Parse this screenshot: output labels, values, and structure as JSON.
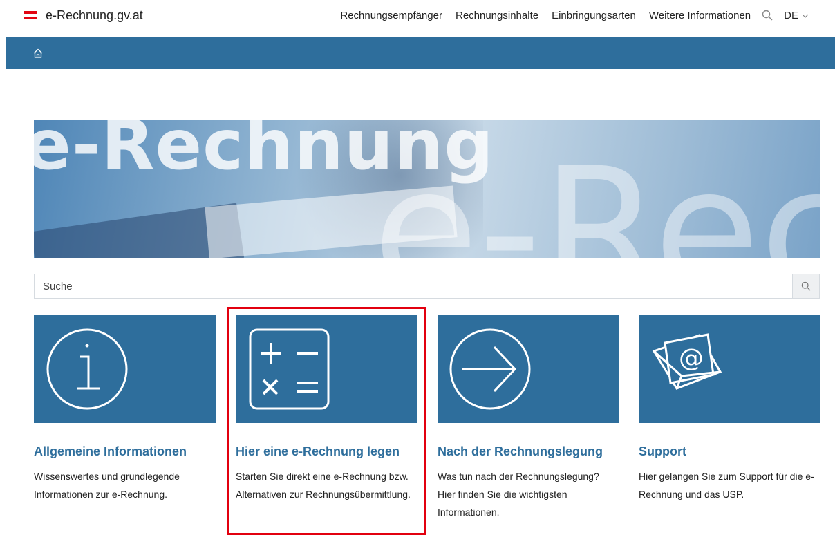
{
  "header": {
    "logo_text": "e-Rechnung.gv.at",
    "nav": [
      "Rechnungsempfänger",
      "Rechnungsinhalte",
      "Einbringungsarten",
      "Weitere Informationen"
    ],
    "search_icon": "search-icon",
    "language": "DE"
  },
  "hero": {
    "title": "e-Rechnung",
    "ghost_text": "e-Rec"
  },
  "search": {
    "placeholder": "Suche"
  },
  "tiles": [
    {
      "title": "Allgemeine Informationen",
      "text": "Wissenswertes und grundlegende Informationen zur e-Rechnung.",
      "icon": "info-icon"
    },
    {
      "title": "Hier eine e-Rechnung legen",
      "text": "Starten Sie direkt eine e-Rechnung bzw. Alternativen zur Rechnungsübermittlung.",
      "icon": "calculator-icon"
    },
    {
      "title": "Nach der Rechnungslegung",
      "text": "Was tun nach der Rechnungslegung? Hier finden Sie die wichtigsten Informationen.",
      "icon": "arrow-right-circle-icon"
    },
    {
      "title": "Support",
      "text": "Hier gelangen Sie zum Support für die e-Rechnung und das USP.",
      "icon": "email-envelope-icon"
    }
  ],
  "colors": {
    "brand": "#2e6e9c",
    "highlight": "#e2000f",
    "flag_red": "#e20613"
  }
}
